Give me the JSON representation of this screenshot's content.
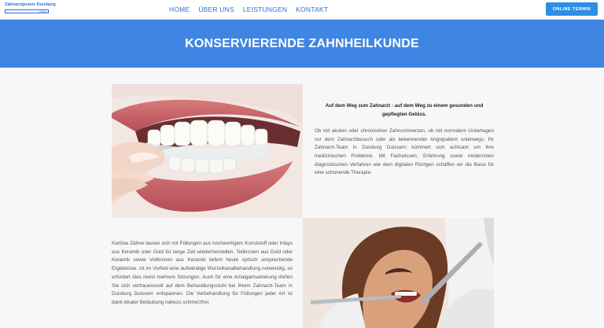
{
  "header": {
    "logo_text": "Zahnarztpraxis Duisburg",
    "logo_sub": "Ruhr",
    "nav": [
      {
        "label": "HOME"
      },
      {
        "label": "ÜBER UNS"
      },
      {
        "label": "LEISTUNGEN"
      },
      {
        "label": "KONTAKT"
      }
    ],
    "cta_label": "ONLINE TERMIN"
  },
  "hero": {
    "title": "KONSERVIERENDE ZAHNHEILKUNDE"
  },
  "section1": {
    "intro": "Auf dem Weg zum Zahnarzt - auf dem Weg zu einem gesunden und gepflegten Gebiss.",
    "body": "Ob mit akuten oder chronischen Zahnschmerzen, ob mit normalem Unbehagen vor dem Zahnarztbesuch oder als bekennender Angstpatient unterwegs: Ihr Zahnarzt-Team in Duisburg Duissern kümmert sich achtsam um ihre medizinischen Probleme. Mit Fachwissen, Erfahrung sowie modernsten diagnostischen Verfahren wie dem digitalen Röntgen schaffen wir die Basis für eine schonende Therapie."
  },
  "section2": {
    "body": "Kariöse Zähne lassen sich mit Füllungen aus hochwertigem Kunststoff oder Inlays aus Keramik oder Gold für lange Zeit wiederherstellen. Teilkronen aus Gold oder Keramik sowie Vollkronen aus Keramik liefern heute optisch ansprechende Ergebnisse. Ist im Vorfeld eine aufwändige Wurzelkanalbehandlung notwendig, so erfordert dies meist mehrere Sitzungen. Auch für eine Amalgamsanierung dürfen Sie sich vertrauensvoll auf dem Behandlungsstuhl bei Ihrem Zahnarzt-Team in Duisburg Duissern entspannen. Die Vorbehandlung für Füllungen jeder Art ist dank lokaler Betäubung nahezu schmerzfrei."
  },
  "colors": {
    "brand": "#2a6fd6",
    "hero": "#3f86e4",
    "cta": "#2c8fe3"
  }
}
